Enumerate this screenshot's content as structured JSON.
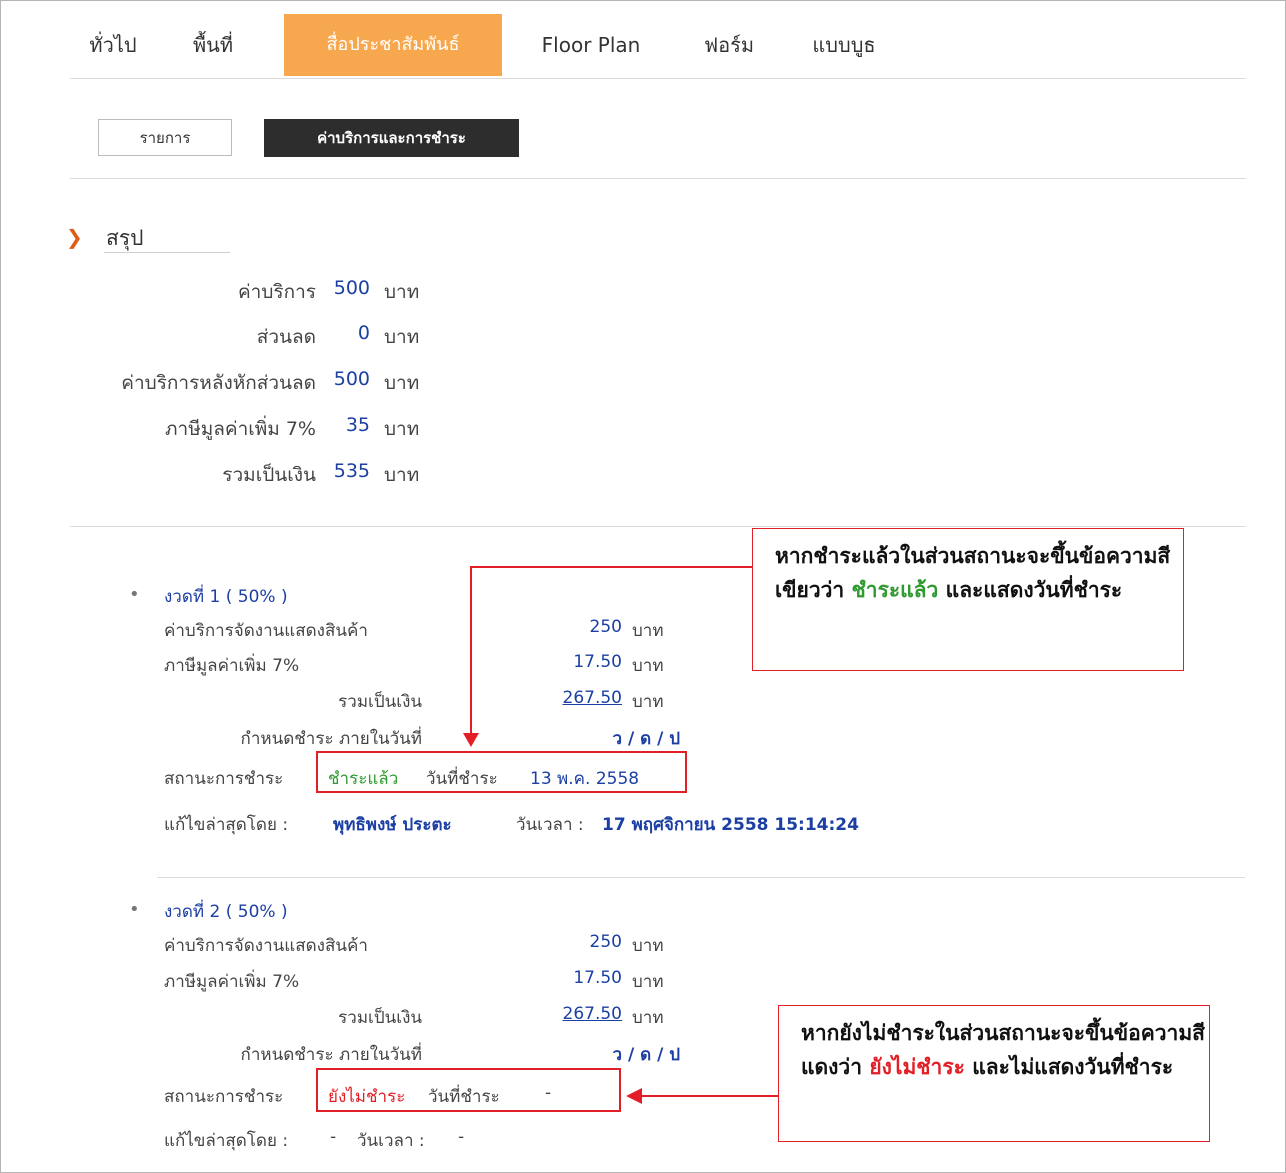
{
  "tabs": [
    "ทั่วไป",
    "พื้นที่",
    "สื่อประชาสัมพันธ์",
    "Floor Plan",
    "ฟอร์ม",
    "แบบบูธ"
  ],
  "subtabs": {
    "list": "รายการ",
    "fees": "ค่าบริการและการชำระ"
  },
  "summary": {
    "heading": "สรุป",
    "rows": [
      {
        "label": "ค่าบริการ",
        "value": "500",
        "unit": "บาท"
      },
      {
        "label": "ส่วนลด",
        "value": "0",
        "unit": "บาท"
      },
      {
        "label": "ค่าบริการหลังหักส่วนลด",
        "value": "500",
        "unit": "บาท"
      },
      {
        "label": "ภาษีมูลค่าเพิ่ม 7%",
        "value": "35",
        "unit": "บาท"
      },
      {
        "label": "รวมเป็นเงิน",
        "value": "535",
        "unit": "บาท"
      }
    ]
  },
  "installments": [
    {
      "title": "งวดที่ 1 ( 50% )",
      "service_label": "ค่าบริการจัดงานแสดงสินค้า",
      "service_value": "250",
      "service_unit": "บาท",
      "vat_label": "ภาษีมูลค่าเพิ่ม 7%",
      "vat_value": "17.50",
      "vat_unit": "บาท",
      "total_label": "รวมเป็นเงิน",
      "total_value": "267.50",
      "total_unit": "บาท",
      "due_label": "กำหนดชำระ ภายในวันที่",
      "due_value": "ว / ด / ป",
      "status_label": "สถานะการชำระ",
      "status_value": "ชำระแล้ว",
      "paydate_label": "วันที่ชำระ",
      "paydate_value": "13 พ.ค. 2558",
      "edited_label": "แก้ไขล่าสุดโดย :",
      "edited_by": "พุทธิพงษ์ ประตะ",
      "time_label": "วันเวลา :",
      "time_value": "17 พฤศจิกายน 2558 15:14:24"
    },
    {
      "title": "งวดที่ 2 ( 50% )",
      "service_label": "ค่าบริการจัดงานแสดงสินค้า",
      "service_value": "250",
      "service_unit": "บาท",
      "vat_label": "ภาษีมูลค่าเพิ่ม 7%",
      "vat_value": "17.50",
      "vat_unit": "บาท",
      "total_label": "รวมเป็นเงิน",
      "total_value": "267.50",
      "total_unit": "บาท",
      "due_label": "กำหนดชำระ ภายในวันที่",
      "due_value": "ว / ด / ป",
      "status_label": "สถานะการชำระ",
      "status_value": "ยังไม่ชำระ",
      "paydate_label": "วันที่ชำระ",
      "paydate_value": "-",
      "edited_label": "แก้ไขล่าสุดโดย :",
      "edited_by": "-",
      "time_label": "วันเวลา :",
      "time_value": "-"
    }
  ],
  "callouts": {
    "paid": {
      "text_before": "หากชำระแล้วในส่วนสถานะจะขึ้นข้อความสีเขียวว่า",
      "highlight": "ชำระแล้ว",
      "text_after": "และแสดงวันที่ชำระ"
    },
    "unpaid": {
      "text_before": "หากยังไม่ชำระในส่วนสถานะจะขึ้นข้อความสีแดงว่า",
      "highlight": "ยังไม่ชำระ",
      "text_after": "และไม่แสดงวันที่ชำระ"
    }
  },
  "colors": {
    "active_tab": "#f7a84e",
    "link_blue": "#1b3fa3",
    "paid_green": "#2f9a2f",
    "unpaid_red": "#e21f26",
    "annotation_red": "#e21f26"
  }
}
